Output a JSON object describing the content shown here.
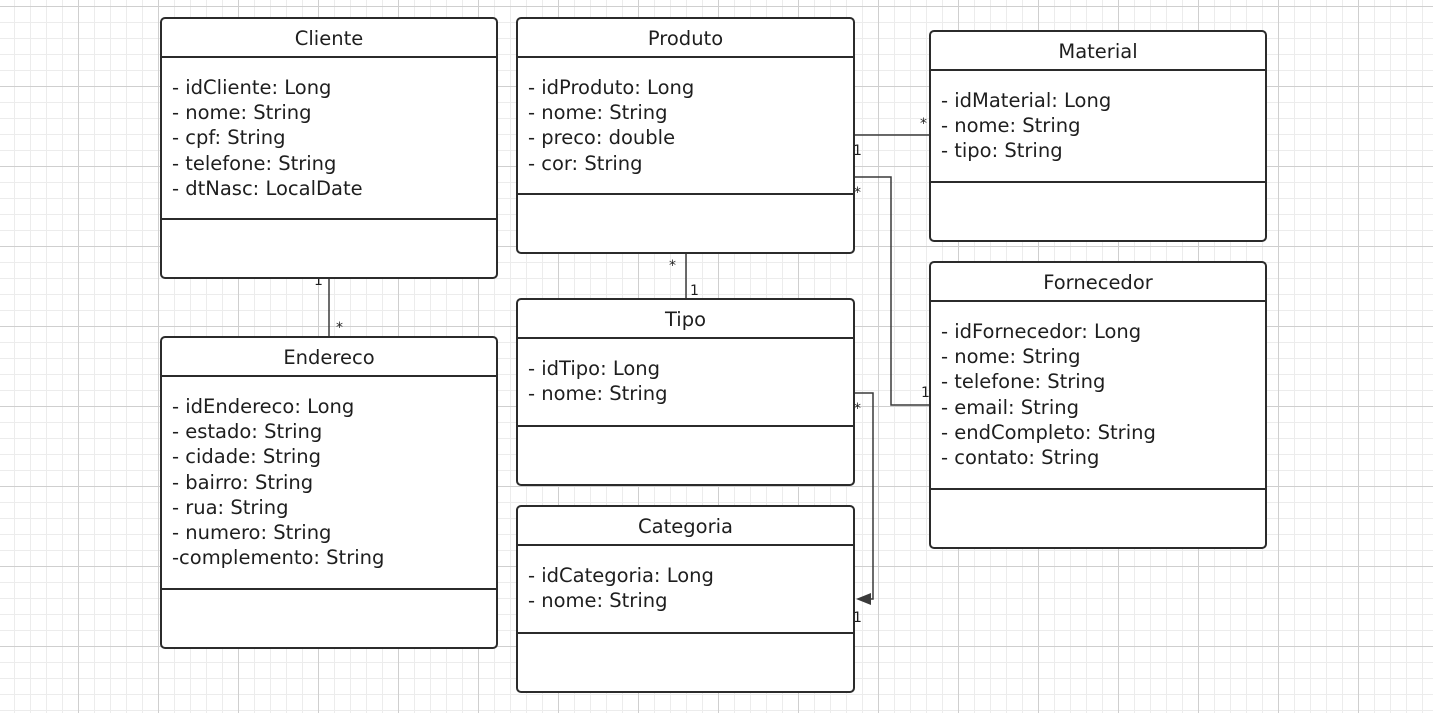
{
  "classes": {
    "cliente": {
      "name": "Cliente",
      "attributes": [
        "- idCliente: Long",
        "- nome: String",
        "- cpf: String",
        "- telefone: String",
        "- dtNasc: LocalDate"
      ]
    },
    "produto": {
      "name": "Produto",
      "attributes": [
        "- idProduto: Long",
        "- nome: String",
        "- preco: double",
        "- cor: String"
      ]
    },
    "material": {
      "name": "Material",
      "attributes": [
        "- idMaterial: Long",
        "- nome: String",
        "- tipo: String"
      ]
    },
    "endereco": {
      "name": "Endereco",
      "attributes": [
        "- idEndereco: Long",
        "- estado: String",
        "- cidade: String",
        "- bairro: String",
        "- rua: String",
        "- numero: String",
        "-complemento: String"
      ]
    },
    "tipo": {
      "name": "Tipo",
      "attributes": [
        "- idTipo: Long",
        "- nome: String"
      ]
    },
    "fornecedor": {
      "name": "Fornecedor",
      "attributes": [
        "- idFornecedor: Long",
        "- nome: String",
        "- telefone: String",
        "- email: String",
        "- endCompleto: String",
        "- contato: String"
      ]
    },
    "categoria": {
      "name": "Categoria",
      "attributes": [
        "- idCategoria: Long",
        "- nome: String"
      ]
    }
  },
  "multiplicities": {
    "cliente_endereco": {
      "one": "1",
      "many": "*"
    },
    "produto_material": {
      "one": "1",
      "many": "*"
    },
    "produto_tipo": {
      "one": "1",
      "many": "*"
    },
    "produto_fornecedor": {
      "one": "1",
      "many": "*"
    },
    "tipo_categoria": {
      "one": "1",
      "many": "*"
    }
  },
  "colors": {
    "border": "#2b2b2b",
    "line": "#3a3a3a",
    "grid_major": "#cfcfcf",
    "grid_minor": "#ececec"
  }
}
